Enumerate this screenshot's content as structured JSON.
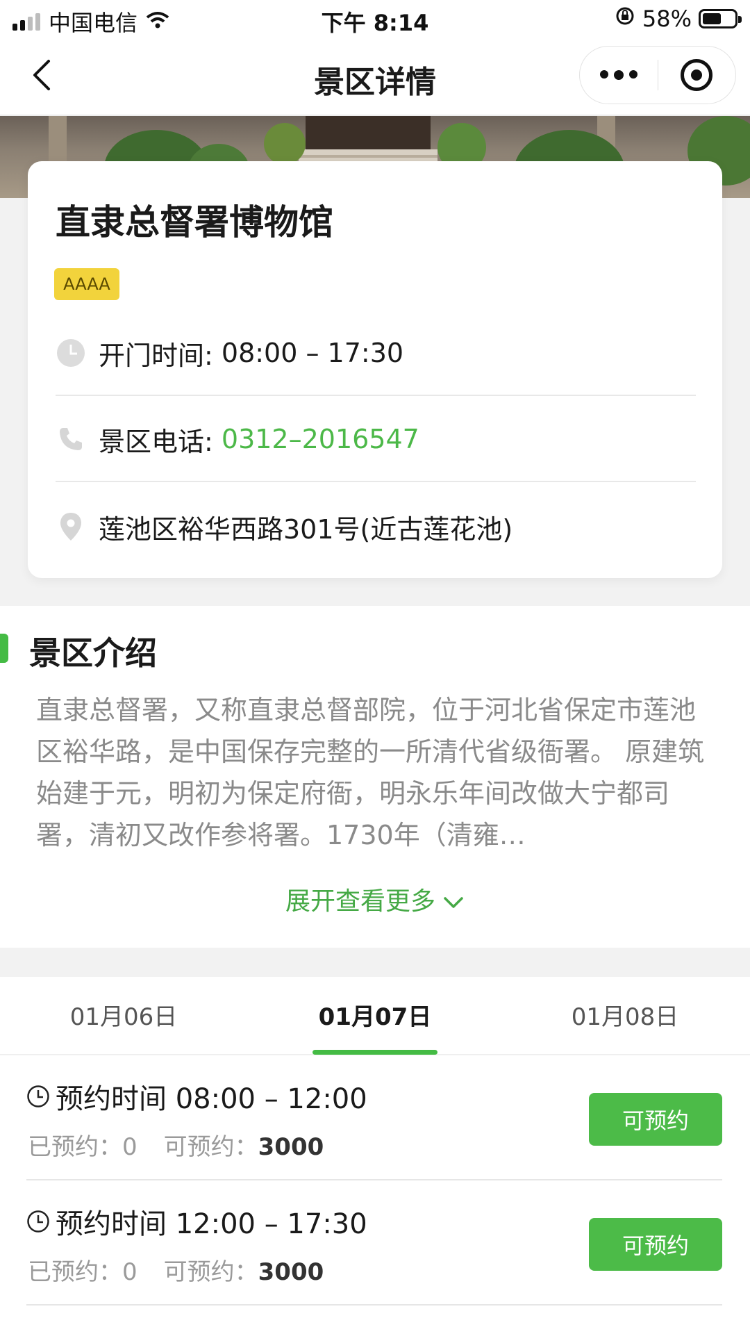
{
  "status_bar": {
    "carrier": "中国电信",
    "time": "下午 8:14",
    "battery": "58%"
  },
  "nav": {
    "title": "景区详情"
  },
  "spot": {
    "name": "直隶总督署博物馆",
    "level": "AAAA",
    "open_label": "开门时间: ",
    "open_hours": "08:00 – 17:30",
    "phone_label": "景区电话: ",
    "phone": "0312–2016547",
    "address": "莲池区裕华西路301号(近古莲花池)"
  },
  "intro": {
    "title": "景区介绍",
    "text": "直隶总督署，又称直隶总督部院，位于河北省保定市莲池区裕华路，是中国保存完整的一所清代省级衙署。 原建筑始建于元，明初为保定府衙，明永乐年间改做大宁都司署，清初又改作参将署。1730年（清雍…",
    "expand_label": "展开查看更多"
  },
  "dates": [
    "01月06日",
    "01月07日",
    "01月08日"
  ],
  "selected_date_index": 1,
  "slots": [
    {
      "time_label": "预约时间 08:00 – 12:00",
      "booked_label": "已预约：",
      "booked": "0",
      "available_label": "可预约：",
      "available": "3000",
      "button": "可预约"
    },
    {
      "time_label": "预约时间 12:00 – 17:30",
      "booked_label": "已预约：",
      "booked": "0",
      "available_label": "可预约：",
      "available": "3000",
      "button": "可预约"
    }
  ],
  "colors": {
    "accent_green": "#4cbb48",
    "level_badge": "#f2d33c"
  },
  "icons": [
    "back-icon",
    "more-icon",
    "close-target-icon",
    "clock-icon",
    "phone-icon",
    "location-icon",
    "chevron-down-icon"
  ]
}
